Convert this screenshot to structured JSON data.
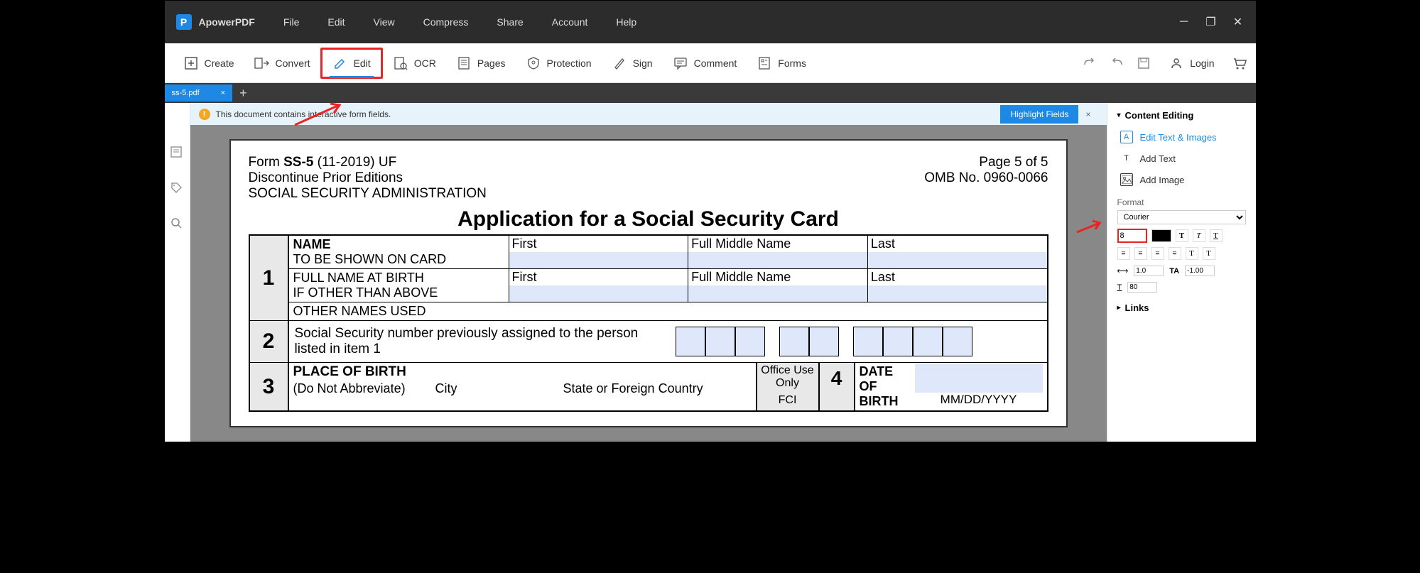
{
  "app": {
    "name": "ApowerPDF"
  },
  "menu": [
    "File",
    "Edit",
    "View",
    "Compress",
    "Share",
    "Account",
    "Help"
  ],
  "toolbar": {
    "create": "Create",
    "convert": "Convert",
    "edit": "Edit",
    "ocr": "OCR",
    "pages": "Pages",
    "protection": "Protection",
    "sign": "Sign",
    "comment": "Comment",
    "forms": "Forms",
    "login": "Login"
  },
  "tab": {
    "name": "ss-5.pdf"
  },
  "notice": {
    "text": "This document contains interactive form fields.",
    "highlight": "Highlight Fields"
  },
  "doc": {
    "form_line": "Form SS-5 (11-2019) UF",
    "discontinue": "Discontinue Prior Editions",
    "ssa": "SOCIAL SECURITY ADMINISTRATION",
    "page_of": "Page 5 of 5",
    "omb": "OMB No. 0960-0066",
    "title": "Application for a Social Security Card",
    "row1": {
      "name": "NAME",
      "shown": "TO BE SHOWN ON CARD",
      "full_birth": "FULL NAME AT BIRTH",
      "if_other": "IF OTHER THAN ABOVE",
      "other_names": "OTHER NAMES USED",
      "first": "First",
      "middle": "Full Middle Name",
      "last": "Last"
    },
    "row2": {
      "text": "Social Security number previously assigned to the person listed in item 1"
    },
    "row3": {
      "pob": "PLACE OF BIRTH",
      "noabbr": "(Do Not Abbreviate)",
      "city": "City",
      "state": "State or Foreign Country",
      "office": "Office Use Only",
      "fci": "FCI",
      "dob": "DATE OF BIRTH",
      "mmdd": "MM/DD/YYYY"
    }
  },
  "rp": {
    "content_editing": "Content Editing",
    "edit_text_images": "Edit Text & Images",
    "add_text": "Add Text",
    "add_image": "Add Image",
    "format": "Format",
    "font": "Courier",
    "size": "8",
    "lh": "1.0",
    "ls": "-1.00",
    "hs": "80",
    "links": "Links"
  }
}
